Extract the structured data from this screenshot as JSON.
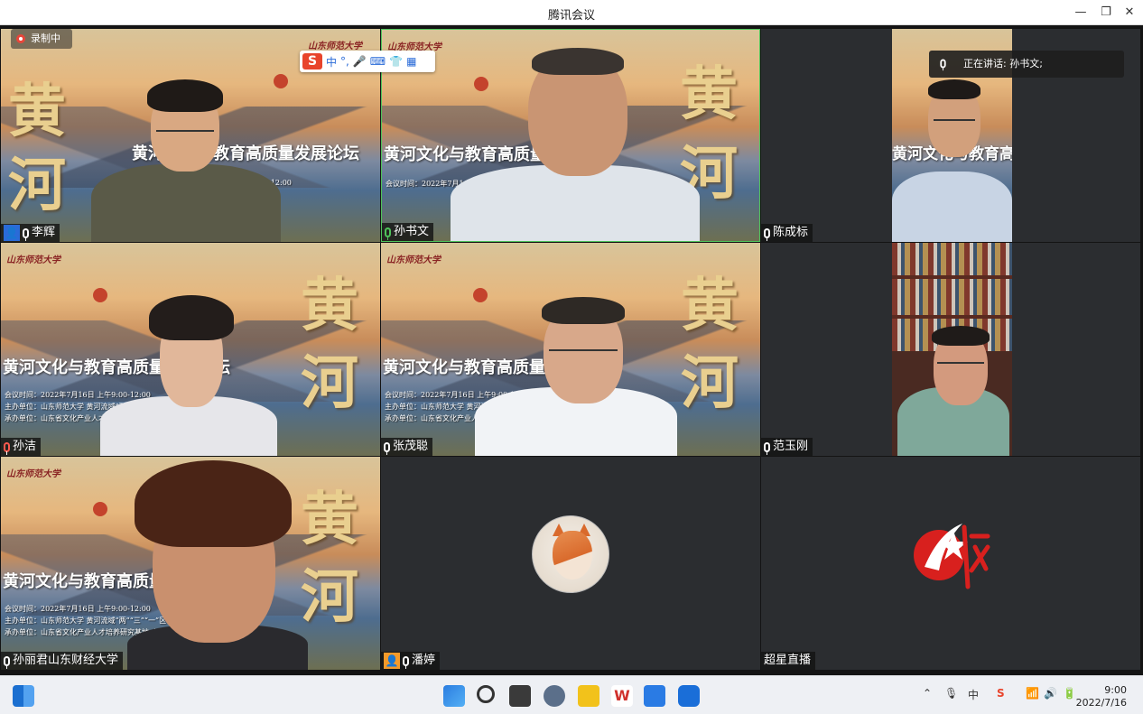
{
  "window": {
    "title": "腾讯会议"
  },
  "recording": {
    "label": "录制中"
  },
  "ime": {
    "mode": "中",
    "punct": "°,"
  },
  "speaking": {
    "label": "正在讲话: 孙书文;"
  },
  "backdrop": {
    "banner": "黄河文化与教育高质量发展论坛",
    "char1": "黄",
    "char2": "河",
    "university": "山东师范大学",
    "info_time": "会议时间：2022年7月16日 上午9:00-12:00",
    "info_host": "主办单位：山东师范大学 黄河流域“两”“三”“一”区中心",
    "info_org": "承办单位：山东省文化产业人才培养研究基地 山东师范大学文学院"
  },
  "participants": [
    {
      "name": "李辉",
      "mic": "on",
      "badge": "host"
    },
    {
      "name": "孙书文",
      "mic": "active"
    },
    {
      "name": "陈成标",
      "mic": "on"
    },
    {
      "name": "孙洁",
      "mic": "muted"
    },
    {
      "name": "张茂聪",
      "mic": "on"
    },
    {
      "name": "范玉刚",
      "mic": "on"
    },
    {
      "name": "孙丽君山东财经大学",
      "mic": "on"
    },
    {
      "name": "潘婷",
      "mic": "on",
      "badge": "user"
    },
    {
      "name": "超星直播",
      "mic": "none"
    }
  ],
  "taskbar": {
    "clock_time": "9:00",
    "clock_date": "2022/7/16",
    "ime_indicator": "中"
  },
  "colors": {
    "accent": "#2a6bd8",
    "active_mic": "#4fc35a",
    "rec": "#e8463a"
  }
}
